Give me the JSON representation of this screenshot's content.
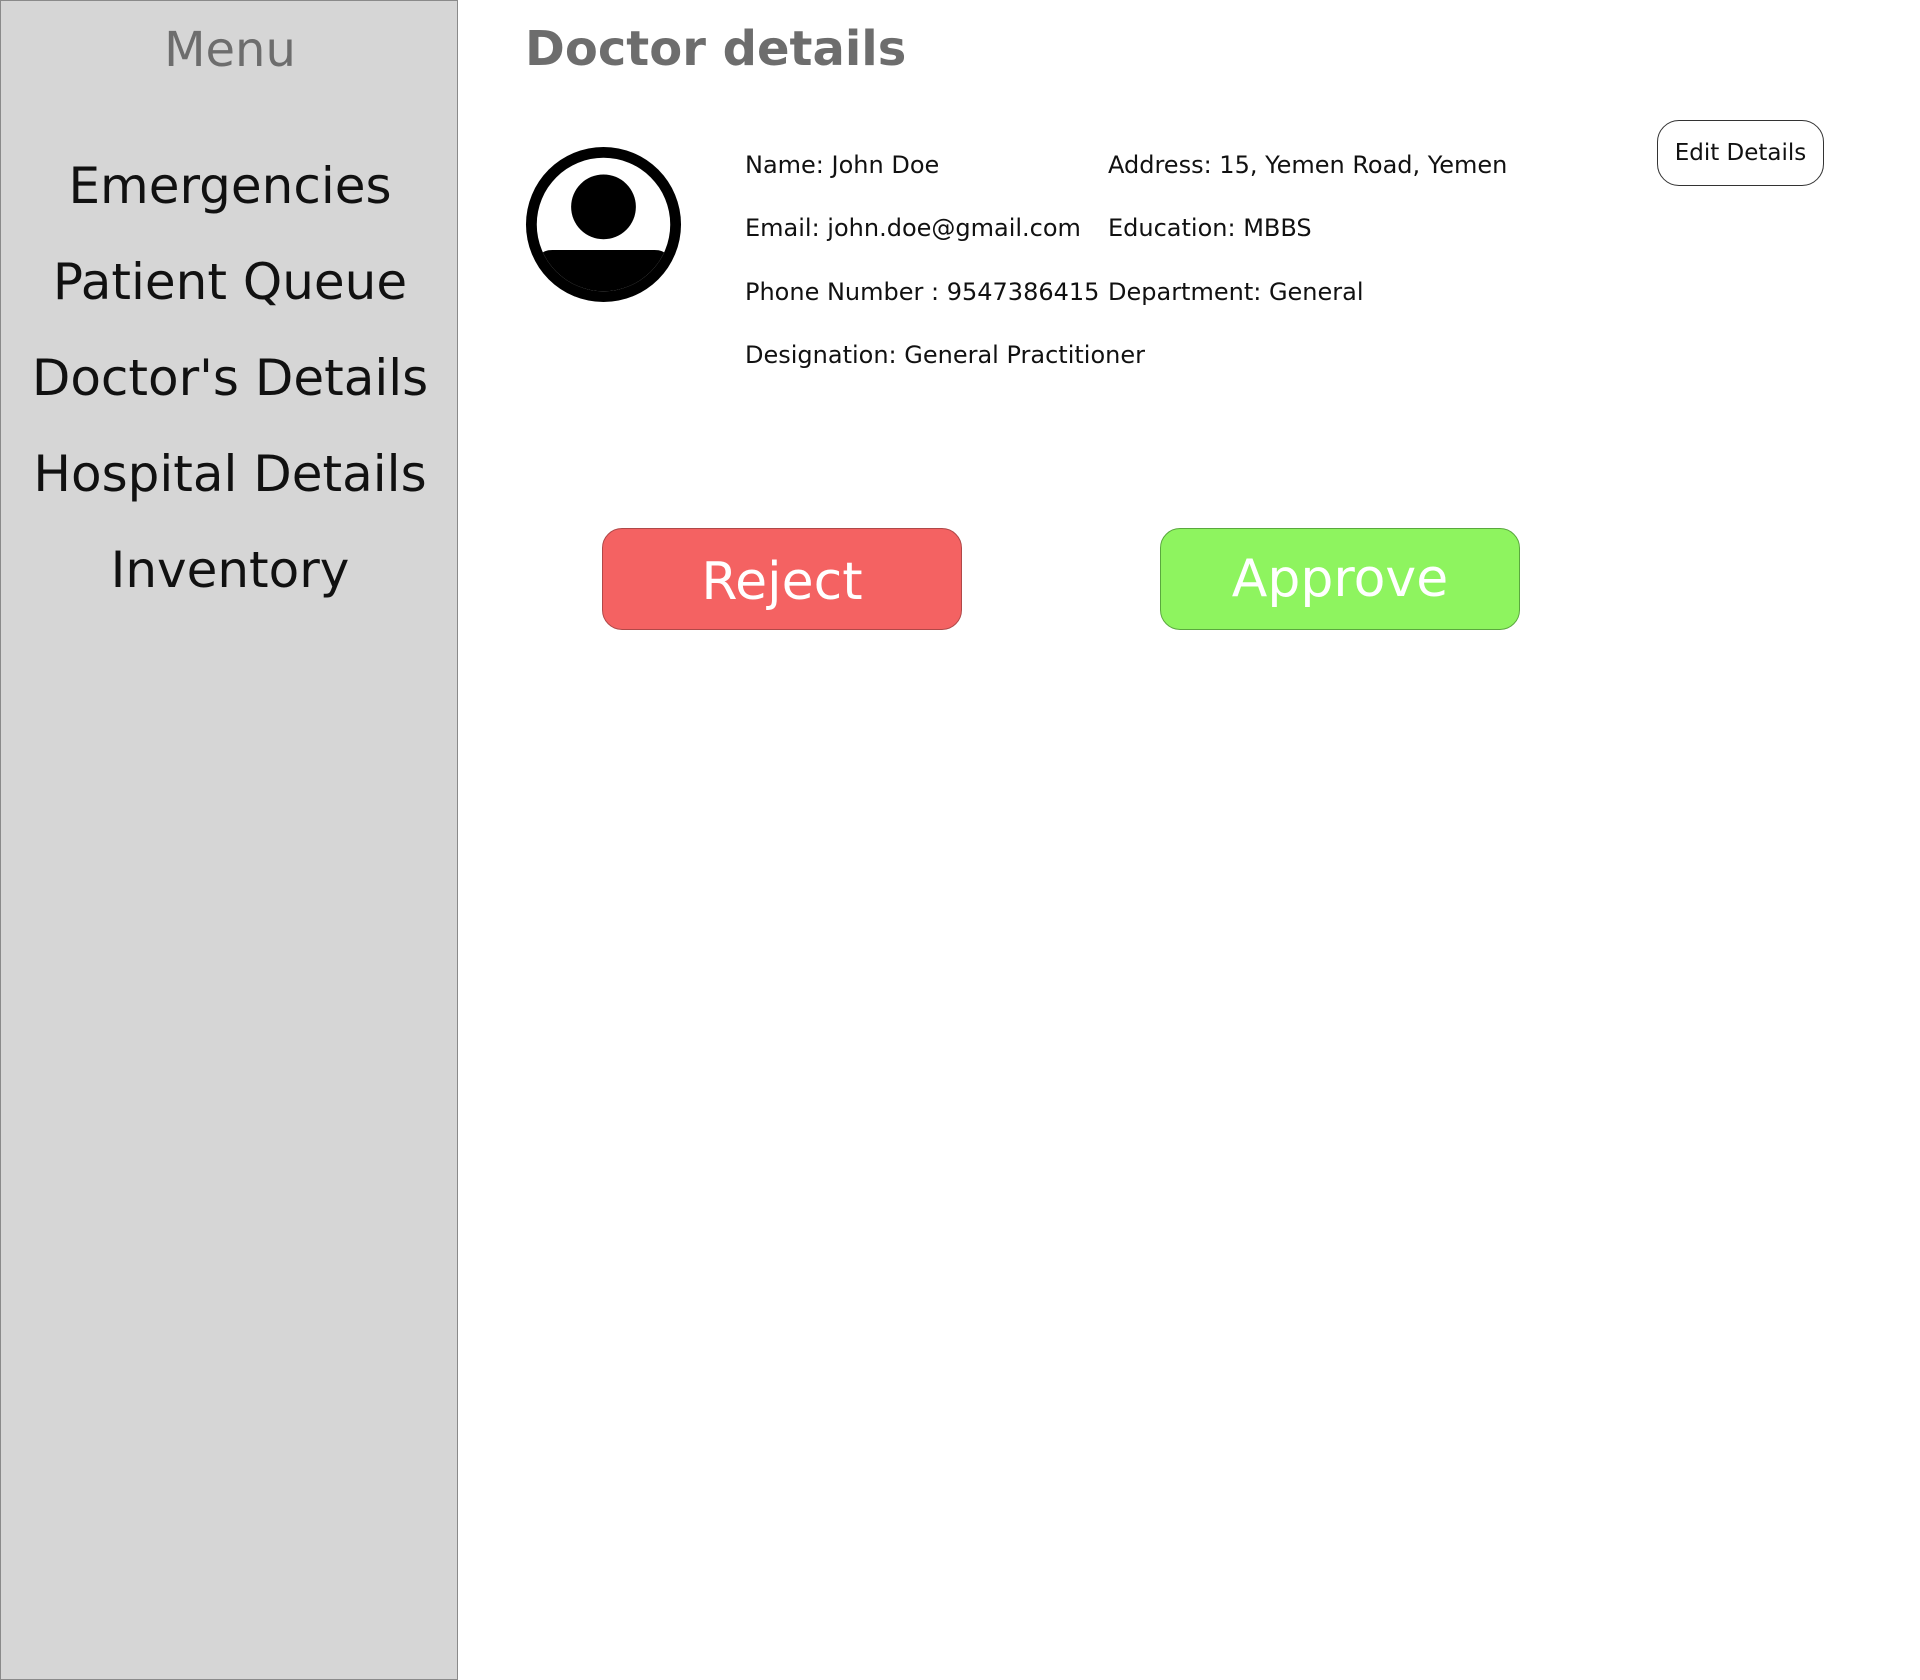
{
  "sidebar": {
    "title": "Menu",
    "items": [
      {
        "label": "Emergencies"
      },
      {
        "label": "Patient Queue"
      },
      {
        "label": "Doctor's Details"
      },
      {
        "label": "Hospital Details"
      },
      {
        "label": "Inventory"
      }
    ]
  },
  "main": {
    "title": "Doctor details",
    "avatar_icon": "user-avatar-icon",
    "details": {
      "name": "Name: John Doe",
      "email": "Email: john.doe@gmail.com",
      "phone": "Phone Number : 9547386415",
      "designation": "Designation: General Practitioner",
      "address": "Address: 15, Yemen Road, Yemen",
      "education": "Education: MBBS",
      "department": "Department: General"
    },
    "edit_button": "Edit Details",
    "reject_button": "Reject",
    "approve_button": "Approve"
  },
  "colors": {
    "sidebar_bg": "#d6d6d6",
    "title_gray": "#6d6d6d",
    "reject": "#f46262",
    "approve": "#8ef45f"
  }
}
